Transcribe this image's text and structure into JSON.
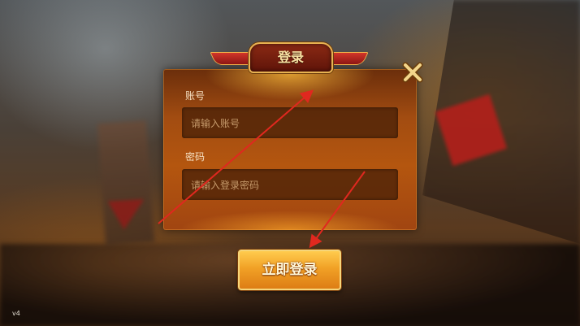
{
  "dialog": {
    "title": "登录",
    "close_icon": "close-x-icon"
  },
  "account": {
    "label": "账号",
    "placeholder": "请输入账号",
    "value": ""
  },
  "password": {
    "label": "密码",
    "placeholder": "请输入登录密码",
    "value": ""
  },
  "login_button": {
    "label": "立即登录"
  },
  "version": {
    "text": "v4"
  },
  "colors": {
    "panel_orange": "#b4560f",
    "button_gold": "#f1a126",
    "annotation_red": "#e0281f"
  }
}
